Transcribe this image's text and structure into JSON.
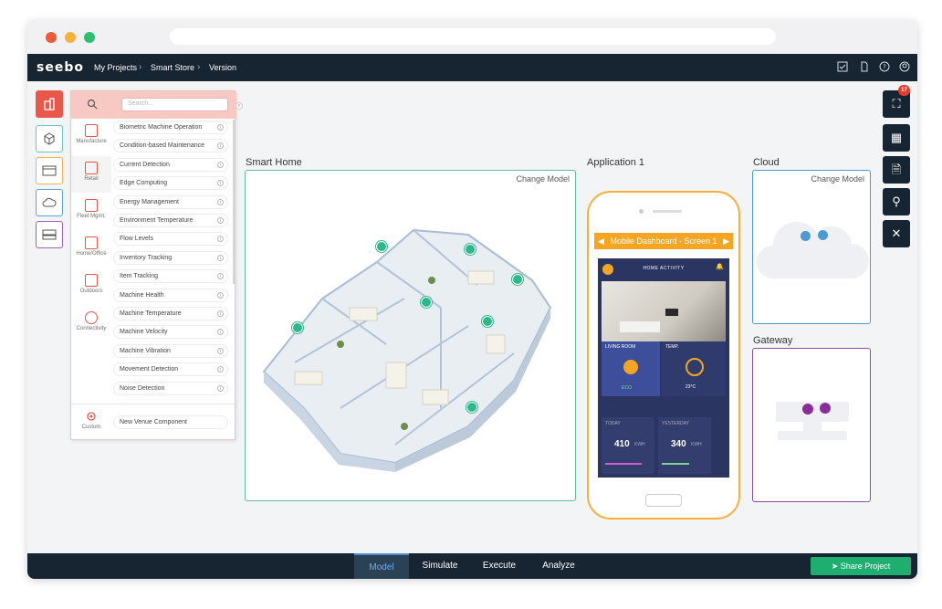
{
  "app": {
    "logo": "seebo"
  },
  "breadcrumb": [
    "My Projects",
    "Smart Store",
    "Version"
  ],
  "panel": {
    "search_placeholder": "Search...",
    "categories": [
      {
        "label": "Manufacture",
        "icon": "factory-icon"
      },
      {
        "label": "Retail",
        "icon": "store-icon"
      },
      {
        "label": "Fleet Mgmt.",
        "icon": "truck-icon"
      },
      {
        "label": "Home/Office",
        "icon": "home-icon"
      },
      {
        "label": "Outdoors",
        "icon": "buildings-icon"
      },
      {
        "label": "Connectivity",
        "icon": "wifi-icon"
      }
    ],
    "items": [
      "Biometric Machine Operation",
      "Condition-based Maintenance",
      "Current Detection",
      "Edge Computing",
      "Energy Management",
      "Environment Temperature",
      "Flow Levels",
      "Inventory Tracking",
      "Item Tracking",
      "Machine Health",
      "Machine Temperature",
      "Machine Velocity",
      "Machine Vibration",
      "Movement Detection",
      "Noise Detection"
    ],
    "custom_label": "Custom",
    "custom_item": "New Venue Component"
  },
  "sections": {
    "smart_home": "Smart Home",
    "application": "Application 1",
    "cloud": "Cloud",
    "gateway": "Gateway",
    "change_model": "Change Model"
  },
  "phone": {
    "banner": "Mobile Dashboard - Screen 1",
    "header": "HOME ACTIVITY",
    "living_room": "LIVING ROOM",
    "temp": "TEMP.",
    "eco": "ECO",
    "temp_value": "23°C",
    "today": "TODAY",
    "yesterday": "YESTERDAY",
    "today_value": "410",
    "yesterday_value": "340",
    "unit": "KWH"
  },
  "right_rail": {
    "badge_count": "17"
  },
  "bottom_tabs": [
    "Model",
    "Simulate",
    "Execute",
    "Analyze"
  ],
  "active_tab": "Model",
  "share_button": "Share Project",
  "colors": {
    "topbar": "#172432",
    "accent_red": "#e25a4e",
    "panel_head": "#f8c9c2",
    "green": "#2fb78c",
    "orange": "#f4a623",
    "share": "#1fae72",
    "cloud_border": "#4c9ad3",
    "gateway_border": "#8a4fa7"
  }
}
